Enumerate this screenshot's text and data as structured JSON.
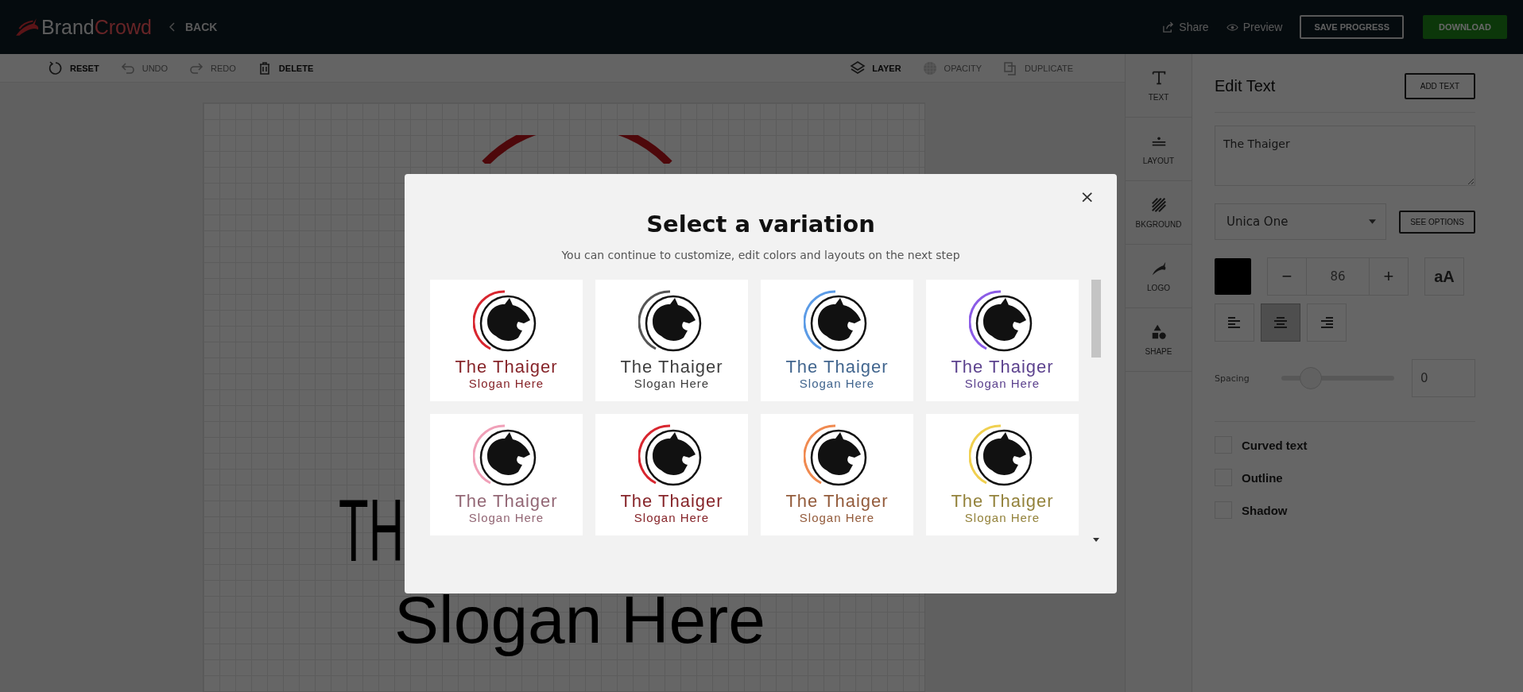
{
  "header": {
    "brand": "Brand",
    "brand_accent": "Crowd",
    "back": "BACK",
    "share": "Share",
    "preview": "Preview",
    "save": "SAVE PROGRESS",
    "download": "DOWNLOAD"
  },
  "toolbar": {
    "left": [
      {
        "kind": "reset",
        "label": "RESET",
        "disabled": false
      },
      {
        "kind": "undo",
        "label": "UNDO",
        "disabled": true
      },
      {
        "kind": "redo",
        "label": "REDO",
        "disabled": true
      },
      {
        "kind": "delete",
        "label": "DELETE",
        "disabled": false
      }
    ],
    "right": [
      {
        "kind": "layer",
        "label": "LAYER",
        "disabled": false
      },
      {
        "kind": "opacity",
        "label": "OPACITY",
        "disabled": true
      },
      {
        "kind": "duplicate",
        "label": "DUPLICATE",
        "disabled": true
      }
    ]
  },
  "canvas": {
    "headline": "TH",
    "slogan": "Slogan Here"
  },
  "side_tools": [
    {
      "kind": "text",
      "label": "TEXT"
    },
    {
      "kind": "layout",
      "label": "LAYOUT"
    },
    {
      "kind": "background",
      "label": "BKGROUND"
    },
    {
      "kind": "logo",
      "label": "LOGO"
    },
    {
      "kind": "shape",
      "label": "SHAPE"
    }
  ],
  "edit_panel": {
    "title": "Edit Text",
    "add_button": "ADD TEXT",
    "text_value": "The Thaiger",
    "font": "Unica One",
    "options_button": "SEE OPTIONS",
    "minus": "−",
    "size": "86",
    "plus": "+",
    "case_button": "aA",
    "align": [
      {
        "kind": "left",
        "selected": false
      },
      {
        "kind": "center",
        "selected": true
      },
      {
        "kind": "right",
        "selected": false
      }
    ],
    "spacing": {
      "label": "Spacing",
      "level": 0.26,
      "value": "0"
    },
    "options": [
      {
        "label": "Curved text",
        "checked": false
      },
      {
        "label": "Outline",
        "checked": false
      },
      {
        "label": "Shadow",
        "checked": false
      }
    ]
  },
  "modal": {
    "close": "×",
    "title": "Select a variation",
    "subtitle": "You can continue to customize, edit colors and layouts on the next step",
    "variations": [
      {
        "name": "The Thaiger",
        "slogan": "Slogan Here",
        "color": "#d8262f"
      },
      {
        "name": "The Thaiger",
        "slogan": "Slogan Here",
        "color": "#555555"
      },
      {
        "name": "The Thaiger",
        "slogan": "Slogan Here",
        "color": "#5b9be6"
      },
      {
        "name": "The Thaiger",
        "slogan": "Slogan Here",
        "color": "#8b5ce6"
      },
      {
        "name": "The Thaiger",
        "slogan": "Slogan Here",
        "color": "#f0a0b8"
      },
      {
        "name": "The Thaiger",
        "slogan": "Slogan Here",
        "color": "#d8262f"
      },
      {
        "name": "The Thaiger",
        "slogan": "Slogan Here",
        "color": "#f08a50"
      },
      {
        "name": "The Thaiger",
        "slogan": "Slogan Here",
        "color": "#f0d050"
      }
    ]
  }
}
